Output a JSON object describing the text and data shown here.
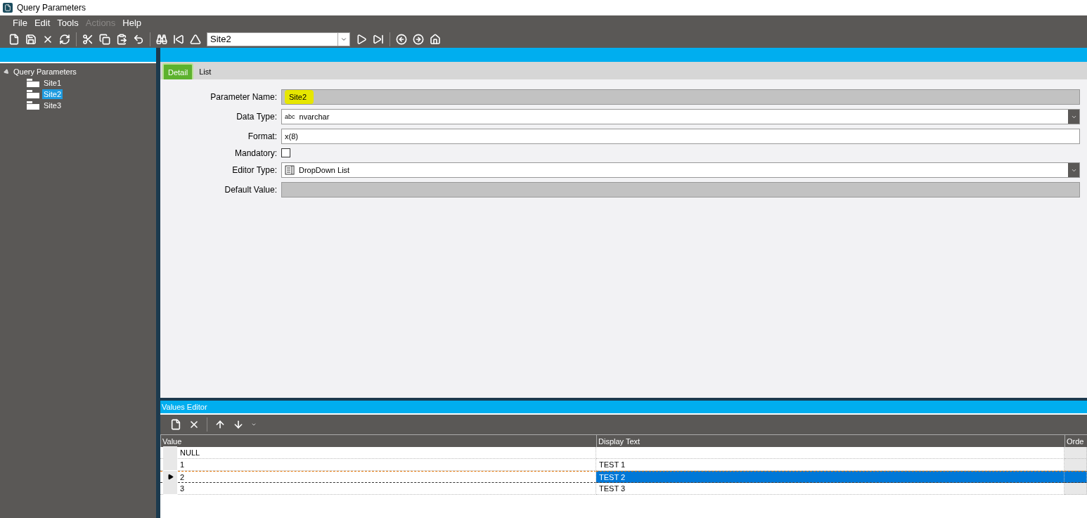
{
  "window": {
    "title": "Query Parameters"
  },
  "menu": [
    {
      "label": "File",
      "disabled": false
    },
    {
      "label": "Edit",
      "disabled": false
    },
    {
      "label": "Tools",
      "disabled": false
    },
    {
      "label": "Actions",
      "disabled": true
    },
    {
      "label": "Help",
      "disabled": false
    }
  ],
  "toolbar": {
    "record": "Site2"
  },
  "tree": {
    "label": "Query Parameters",
    "expanded": true,
    "children": [
      {
        "label": "Site1",
        "selected": false
      },
      {
        "label": "Site2",
        "selected": true
      },
      {
        "label": "Site3",
        "selected": false
      }
    ]
  },
  "tabs": [
    {
      "label": "Detail",
      "selected": true
    },
    {
      "label": "List",
      "selected": false
    }
  ],
  "fields": [
    {
      "kind": "readonly",
      "label": "Parameter Name:",
      "value": "Site2",
      "highlighted": true
    },
    {
      "kind": "type-dropdown",
      "label": "Data Type:",
      "value": "nvarchar",
      "badge": "abc"
    },
    {
      "kind": "text",
      "label": "Format:",
      "value": "x(8)"
    },
    {
      "kind": "checkbox",
      "label": "Mandatory:",
      "checked": false
    },
    {
      "kind": "list-dropdown",
      "label": "Editor Type:",
      "value": "DropDown List"
    },
    {
      "kind": "readonly",
      "label": "Default Value:"
    }
  ],
  "values_editor": {
    "title": "Values Editor",
    "columns": [
      "Value",
      "Display Text",
      "Orde"
    ],
    "rows": [
      {
        "value": "NULL",
        "selected": false
      },
      {
        "value": "1",
        "display": "TEST 1",
        "selected": false
      },
      {
        "value": "2",
        "display": "TEST 2",
        "selected": true
      },
      {
        "value": "3",
        "display": "TEST 3",
        "selected": false
      }
    ]
  }
}
